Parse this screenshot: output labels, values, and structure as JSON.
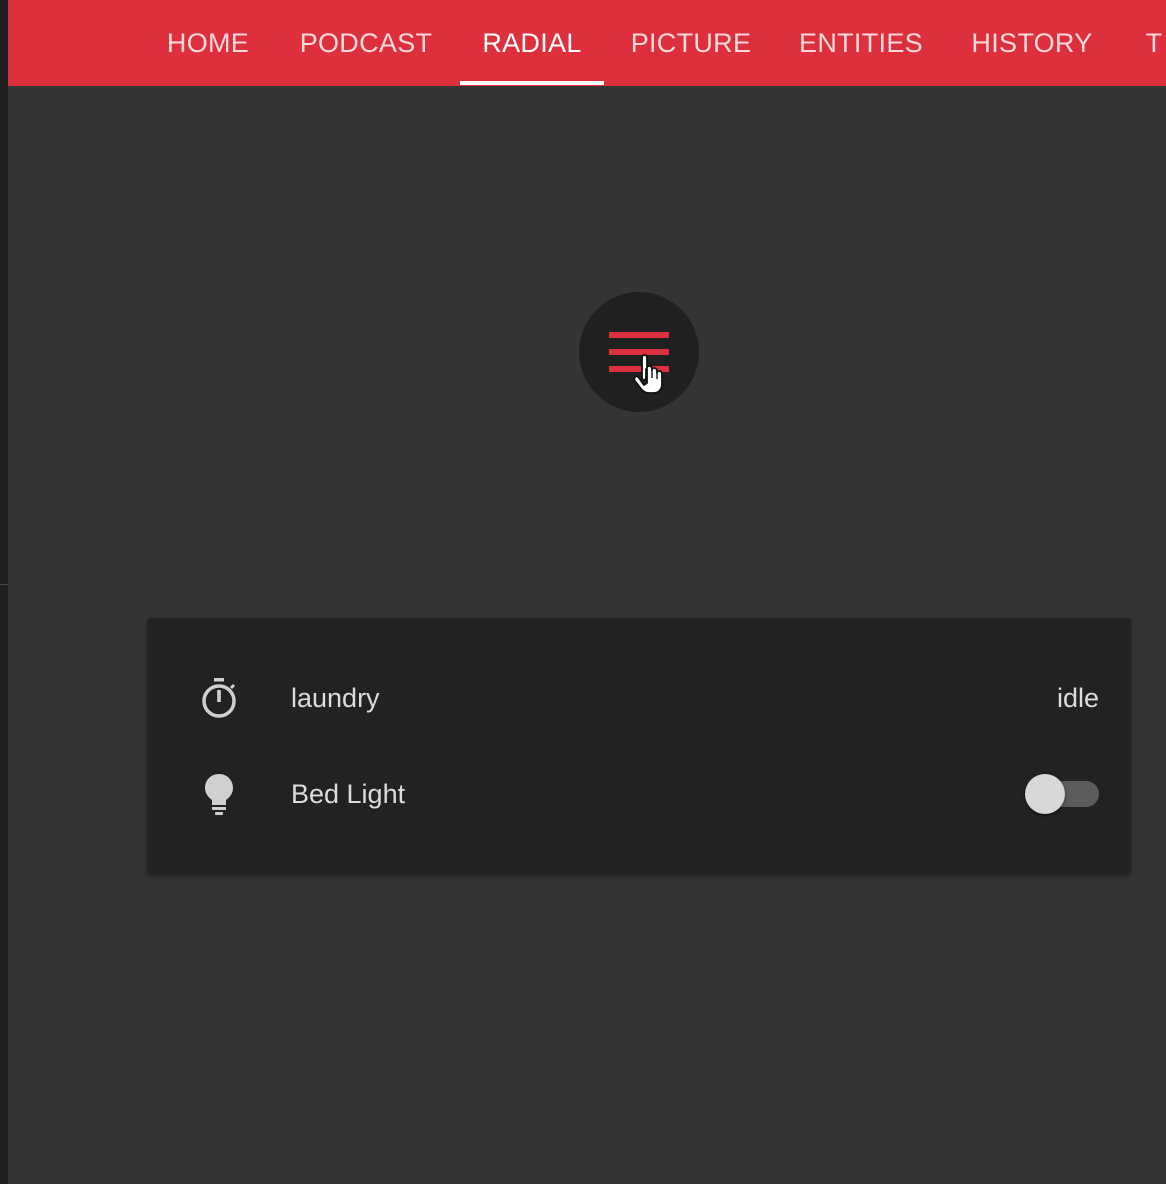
{
  "tabs": [
    {
      "label": "HOME",
      "active": false
    },
    {
      "label": "PODCAST",
      "active": false
    },
    {
      "label": "RADIAL",
      "active": true
    },
    {
      "label": "PICTURE",
      "active": false
    },
    {
      "label": "ENTITIES",
      "active": false
    },
    {
      "label": "HISTORY",
      "active": false
    },
    {
      "label": "T",
      "active": false
    }
  ],
  "colors": {
    "accent": "#dd2f3c",
    "background": "#353535",
    "card": "#222222",
    "fab": "#202020"
  },
  "radial_menu": {
    "icon": "menu-icon",
    "cursor": "hand-pointer-icon"
  },
  "entities": [
    {
      "icon": "timer-icon",
      "name": "laundry",
      "state": "idle"
    },
    {
      "icon": "lightbulb-icon",
      "name": "Bed Light",
      "state": "off",
      "control": "toggle"
    }
  ]
}
